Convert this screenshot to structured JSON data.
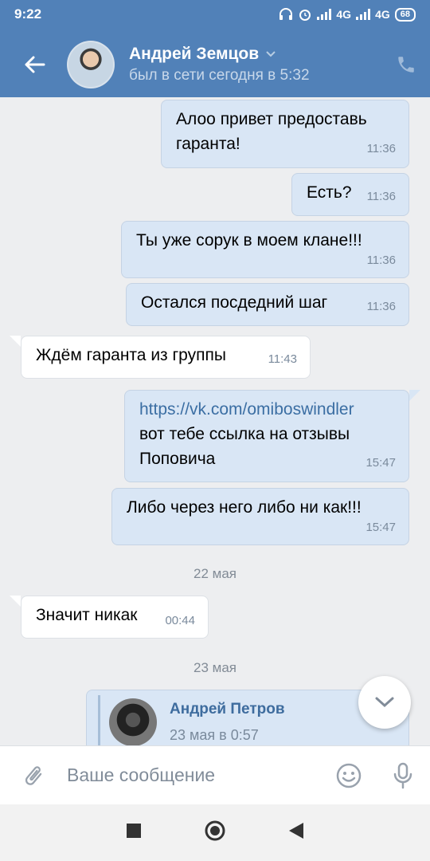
{
  "status": {
    "time": "9:22",
    "net1": "4G",
    "net2": "4G",
    "battery": "68"
  },
  "header": {
    "name": "Андрей Земцов",
    "last_seen": "был в сети сегодня в 5:32"
  },
  "messages": [
    {
      "lines": [
        "Алоо привет предоставь",
        "гаранта!"
      ],
      "time": "11:36"
    },
    {
      "text": "Есть?",
      "time": "11:36"
    },
    {
      "text": "Ты уже сорук в моем клане!!!",
      "time": "11:36"
    },
    {
      "text": "Остался посдедний шаг",
      "time": "11:36"
    },
    {
      "text": "Ждём гаранта из группы",
      "time": "11:43"
    },
    {
      "link": "https://vk.com/omiboswindler",
      "lines": [
        "вот тебе ссылка на отзывы",
        "Поповича"
      ],
      "time": "15:47"
    },
    {
      "text": "Либо через него либо ни как!!!",
      "time": "15:47"
    },
    {
      "text": "Значит никак",
      "time": "00:44"
    }
  ],
  "dates": [
    "22 мая",
    "23 мая"
  ],
  "forward": {
    "name": "Андрей Петров",
    "time": "23 мая в 0:57"
  },
  "input": {
    "placeholder": "Ваше сообщение"
  }
}
